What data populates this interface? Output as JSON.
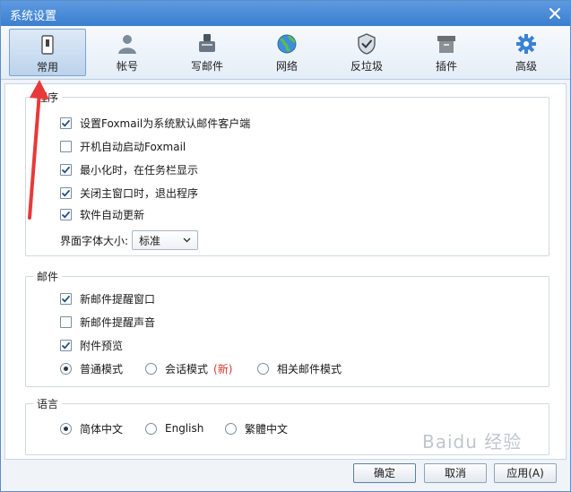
{
  "window": {
    "title": "系统设置"
  },
  "toolbar": {
    "items": [
      {
        "label": "常用",
        "icon": "switch-icon"
      },
      {
        "label": "帐号",
        "icon": "user-icon"
      },
      {
        "label": "写邮件",
        "icon": "compose-icon"
      },
      {
        "label": "网络",
        "icon": "globe-icon"
      },
      {
        "label": "反垃圾",
        "icon": "shield-icon"
      },
      {
        "label": "插件",
        "icon": "box-icon"
      },
      {
        "label": "高级",
        "icon": "gear-icon"
      }
    ],
    "active": "常用"
  },
  "program": {
    "title": "程序",
    "options": [
      {
        "label": "设置Foxmail为系统默认邮件客户端",
        "checked": true
      },
      {
        "label": "开机自动启动Foxmail",
        "checked": false
      },
      {
        "label": "最小化时，在任务栏显示",
        "checked": true
      },
      {
        "label": "关闭主窗口时，退出程序",
        "checked": true
      },
      {
        "label": "软件自动更新",
        "checked": true
      }
    ],
    "font_size_label": "界面字体大小:",
    "font_size_value": "标准"
  },
  "mail": {
    "title": "邮件",
    "options": [
      {
        "label": "新邮件提醒窗口",
        "checked": true
      },
      {
        "label": "新邮件提醒声音",
        "checked": false
      },
      {
        "label": "附件预览",
        "checked": true
      }
    ],
    "modes": [
      {
        "label": "普通模式",
        "selected": true
      },
      {
        "label": "会话模式",
        "selected": false,
        "tag": "(新)"
      },
      {
        "label": "相关邮件模式",
        "selected": false
      }
    ]
  },
  "language": {
    "title": "语言",
    "options": [
      {
        "label": "简体中文",
        "selected": true
      },
      {
        "label": "English",
        "selected": false
      },
      {
        "label": "繁體中文",
        "selected": false
      }
    ]
  },
  "footer": {
    "ok_label": "确定",
    "cancel_label": "取消",
    "apply_label": "应用(A)"
  },
  "watermark": "Baidu 经验",
  "colors": {
    "accent": "#3b7fcf",
    "check": "#1f4f86",
    "new_tag": "#d23a2a",
    "arrow": "#e8393a"
  }
}
